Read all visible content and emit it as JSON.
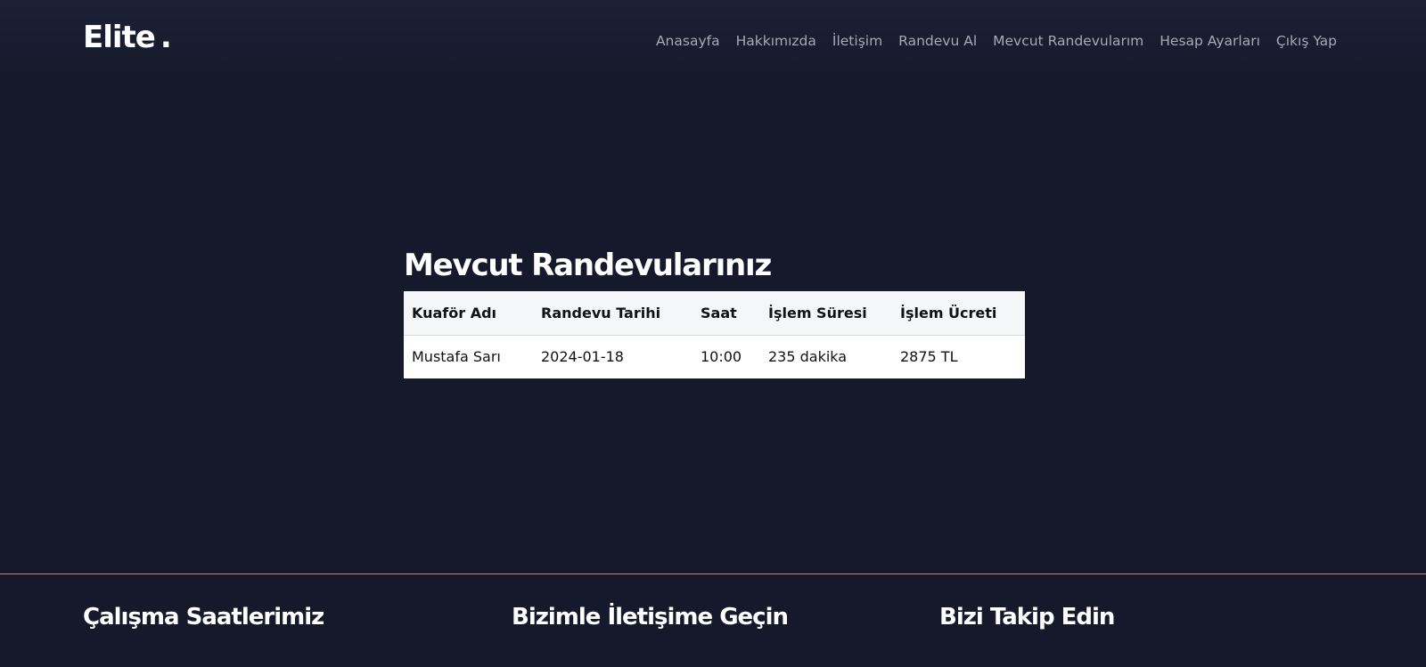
{
  "header": {
    "logo_text": "Elite",
    "logo_dot": ".",
    "nav": [
      {
        "label": "Anasayfa"
      },
      {
        "label": "Hakkımızda"
      },
      {
        "label": "İletişim"
      },
      {
        "label": "Randevu Al"
      },
      {
        "label": "Mevcut Randevularım"
      },
      {
        "label": "Hesap Ayarları"
      },
      {
        "label": "Çıkış Yap"
      }
    ]
  },
  "main": {
    "title": "Mevcut Randevularınız",
    "table": {
      "columns": [
        "Kuaför Adı",
        "Randevu Tarihi",
        "Saat",
        "İşlem Süresi",
        "İşlem Ücreti"
      ],
      "rows": [
        [
          "Mustafa Sarı",
          "2024-01-18",
          "10:00",
          "235 dakika",
          "2875 TL"
        ]
      ]
    }
  },
  "footer": {
    "headings": [
      "Çalışma Saatlerimiz",
      "Bizimle İletişime Geçin",
      "Bizi Takip Edin"
    ]
  },
  "colors": {
    "background": "#15192b",
    "footer_accent": "#c98a62",
    "nav_text": "#a6a9b6"
  }
}
